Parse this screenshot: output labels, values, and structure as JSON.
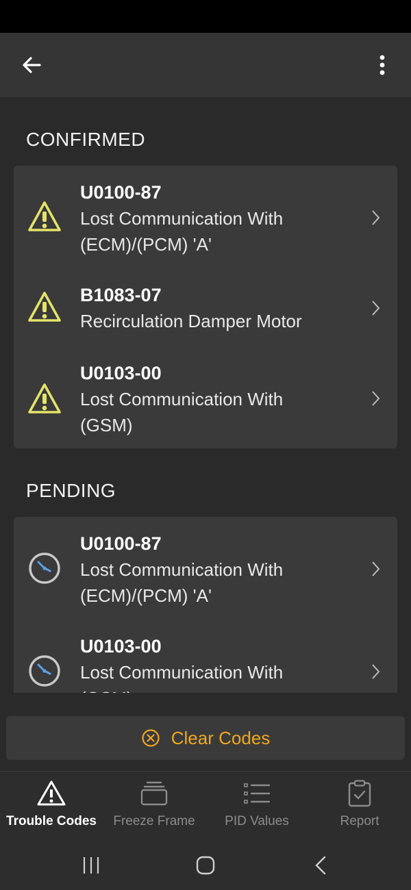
{
  "app_bar": {
    "back_icon": "arrow-left-icon",
    "menu_icon": "more-vert-icon"
  },
  "sections": [
    {
      "title": "CONFIRMED",
      "items": [
        {
          "code": "U0100-87",
          "desc_lines": [
            "Lost Communication With",
            "(ECM)/(PCM) 'A'"
          ],
          "icon": "warning-icon"
        },
        {
          "code": "B1083-07",
          "desc_lines": [
            "Recirculation Damper Motor"
          ],
          "icon": "warning-icon"
        },
        {
          "code": "U0103-00",
          "desc_lines": [
            "Lost Communication With",
            "(GSM)"
          ],
          "icon": "warning-icon"
        }
      ]
    },
    {
      "title": "PENDING",
      "items": [
        {
          "code": "U0100-87",
          "desc_lines": [
            "Lost Communication With",
            "(ECM)/(PCM) 'A'"
          ],
          "icon": "clock-icon"
        },
        {
          "code": "U0103-00",
          "desc_lines": [
            "Lost Communication With",
            "(GSM)"
          ],
          "icon": "clock-icon"
        }
      ]
    }
  ],
  "clear_button": {
    "label": "Clear Codes",
    "icon": "close-circle-icon",
    "color": "#f0a81c"
  },
  "bottom_nav": [
    {
      "label": "Trouble Codes",
      "icon": "warning-outline-icon",
      "active": true
    },
    {
      "label": "Freeze Frame",
      "icon": "stack-icon",
      "active": false
    },
    {
      "label": "PID Values",
      "icon": "list-icon",
      "active": false
    },
    {
      "label": "Report",
      "icon": "clipboard-check-icon",
      "active": false
    }
  ],
  "colors": {
    "warning": "#e4e46a",
    "clock_hand": "#5aa0e6",
    "accent": "#f0a81c"
  }
}
